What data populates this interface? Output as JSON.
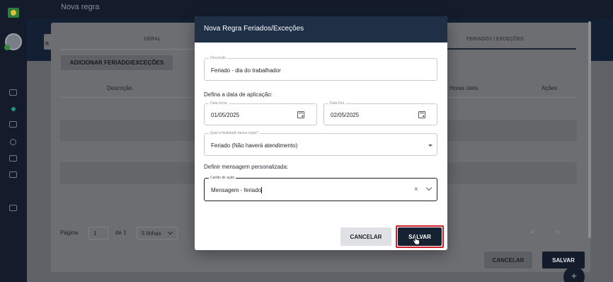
{
  "app": {
    "page_title": "Nova regra"
  },
  "tabs": [
    {
      "label": "GERAL"
    },
    {
      "label": "FERIADOS / EXCEÇÕES"
    }
  ],
  "background": {
    "tab_stub_letter": "R",
    "add_button": "ADICIONAR FERIADO/EXCEÇÕES",
    "table_headers": [
      "Descrição",
      "Horas úteis",
      "Ações"
    ],
    "pager": {
      "label": "Página",
      "page": "1",
      "of_label": "de 1",
      "rows": "5 linhas",
      "prev": "<",
      "next": ">"
    },
    "cancel_label": "CANCELAR",
    "save_label": "SALVAR",
    "fab_label": "+"
  },
  "dialog": {
    "title": "Nova Regra Feriados/Exceções",
    "description": {
      "legend": "Descrição",
      "value": "Feriado - dia do trabalhador"
    },
    "date_section_label": "Defina a data de aplicação:",
    "start_date": {
      "legend": "Data Início",
      "value": "01/05/2025"
    },
    "end_date": {
      "legend": "Data Fim",
      "value": "02/05/2025"
    },
    "purpose": {
      "legend": "Qual a finalidade dessa regra?",
      "value": "Feriado (Não haverá atendimento)"
    },
    "message_section_label": "Definir mensagem personalizada:",
    "action_card": {
      "legend": "Cartão de ação",
      "value": "Mensagem - feriado"
    },
    "cancel_label": "CANCELAR",
    "save_label": "SALVAR"
  },
  "colors": {
    "header_navy": "#1f2f46",
    "save_button": "#162132",
    "highlight_outline": "#d11f2a"
  }
}
